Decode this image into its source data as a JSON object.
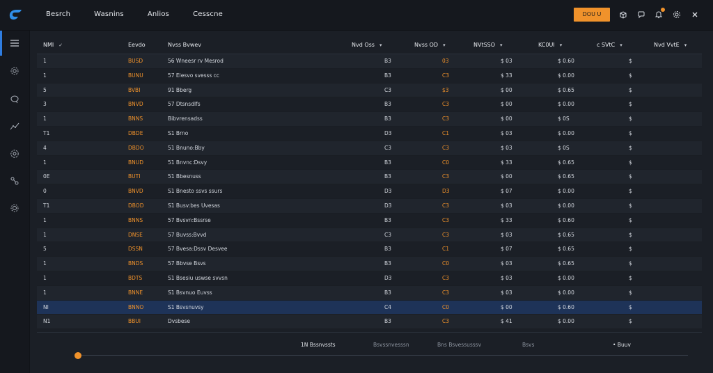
{
  "topbar": {
    "nav": [
      "Besrch",
      "Wasnins",
      "Anlios",
      "Cesscne"
    ],
    "primary_button": "DOU  U",
    "icons": [
      "box-icon",
      "chat-icon",
      "bell-icon",
      "settings-icon",
      "close-icon"
    ]
  },
  "sidebar": {
    "icons": [
      "menu-icon",
      "gear-icon",
      "chat-bubble-icon",
      "analytics-icon",
      "cog-icon",
      "network-icon",
      "settings-gear-icon"
    ]
  },
  "table": {
    "headers": [
      "NMI",
      "Eevdo",
      "Nvss Bvwev",
      "Nvd Oss",
      "Nvss OD",
      "NVtSSO",
      "KC0UI",
      "c SVtC",
      "Nvd VvtE"
    ],
    "rows": [
      [
        "1",
        "BUSD",
        "56  Wneesr rv Mesrod",
        "B3",
        "03",
        "$ 03",
        "$ 0.60",
        "$"
      ],
      [
        "1",
        "BUNU",
        "57  Elesvo svesss cc",
        "B3",
        "C3",
        "$ 33",
        "$ 0.00",
        "$"
      ],
      [
        "5",
        "BVBI",
        "91  Bberg",
        "C3",
        "$3",
        "$ 00",
        "$ 0.65",
        "$"
      ],
      [
        "3",
        "BNVD",
        "57  Dtsnsdlfs",
        "B3",
        "C3",
        "$ 00",
        "$ 0.00",
        "$"
      ],
      [
        "1",
        "BNNS",
        "Bibvrensadss",
        "B3",
        "C3",
        "$ 00",
        "$ 0S",
        "$"
      ],
      [
        "T1",
        "DBDE",
        "S1  Brno",
        "D3",
        "C1",
        "$ 03",
        "$ 0.00",
        "$"
      ],
      [
        "4",
        "DBDO",
        "51  Bnuno:Bby",
        "C3",
        "C3",
        "$ 03",
        "$ 0S",
        "$"
      ],
      [
        "1",
        "BNUD",
        "51  Bnvnc:Dsvy",
        "B3",
        "C0",
        "$ 33",
        "$ 0.65",
        "$"
      ],
      [
        "0E",
        "BUTI",
        "51  Bbesnuss",
        "B3",
        "C3",
        "$ 00",
        "$ 0.65",
        "$"
      ],
      [
        "0",
        "BNVD",
        "S1  Bnesto ssvs ssurs",
        "D3",
        "D3",
        "$ 07",
        "$ 0.00",
        "$"
      ],
      [
        "T1",
        "DBOD",
        "S1  Busv:bes Uvesas",
        "D3",
        "C3",
        "$ 03",
        "$ 0.00",
        "$"
      ],
      [
        "1",
        "BNNS",
        "57  Bvsvn:Bssrse",
        "B3",
        "C3",
        "$ 33",
        "$ 0.60",
        "$"
      ],
      [
        "1",
        "DNSE",
        "57  Buvss:Bvvd",
        "C3",
        "C3",
        "$ 03",
        "$ 0.65",
        "$"
      ],
      [
        "5",
        "DSSN",
        "57  Bvesa:Dssv Desvee",
        "B3",
        "C1",
        "$ 07",
        "$ 0.65",
        "$"
      ],
      [
        "1",
        "BNDS",
        "57  Bbvse Bsvs",
        "B3",
        "C0",
        "$ 03",
        "$ 0.65",
        "$"
      ],
      [
        "1",
        "BDTS",
        "S1  Bsesiu uswse svvsn",
        "D3",
        "C3",
        "$ 03",
        "$ 0.00",
        "$"
      ],
      [
        "1",
        "BNNE",
        "S1  Bsvnuo Euvss",
        "B3",
        "C3",
        "$ 03",
        "$ 0.00",
        "$"
      ],
      [
        "NI",
        "BNNO",
        "S1  Bsvsnuvsy",
        "C4",
        "C0",
        "$ 00",
        "$ 0.60",
        "$"
      ],
      [
        "N1",
        "BBUI",
        "Dvsbese",
        "B3",
        "C3",
        "$ 41",
        "$ 0.00",
        "$"
      ]
    ]
  },
  "footer": {
    "items": [
      "1N  Bssnvssts",
      "Bsvssnvesssn",
      "Bns  Bsvessusssv",
      "Bsvs",
      "•  Buuv"
    ]
  },
  "slider": {
    "value": 0
  },
  "colors": {
    "accent": "#f0922b",
    "selected": "#1e3358",
    "active": "#2f7de1"
  }
}
